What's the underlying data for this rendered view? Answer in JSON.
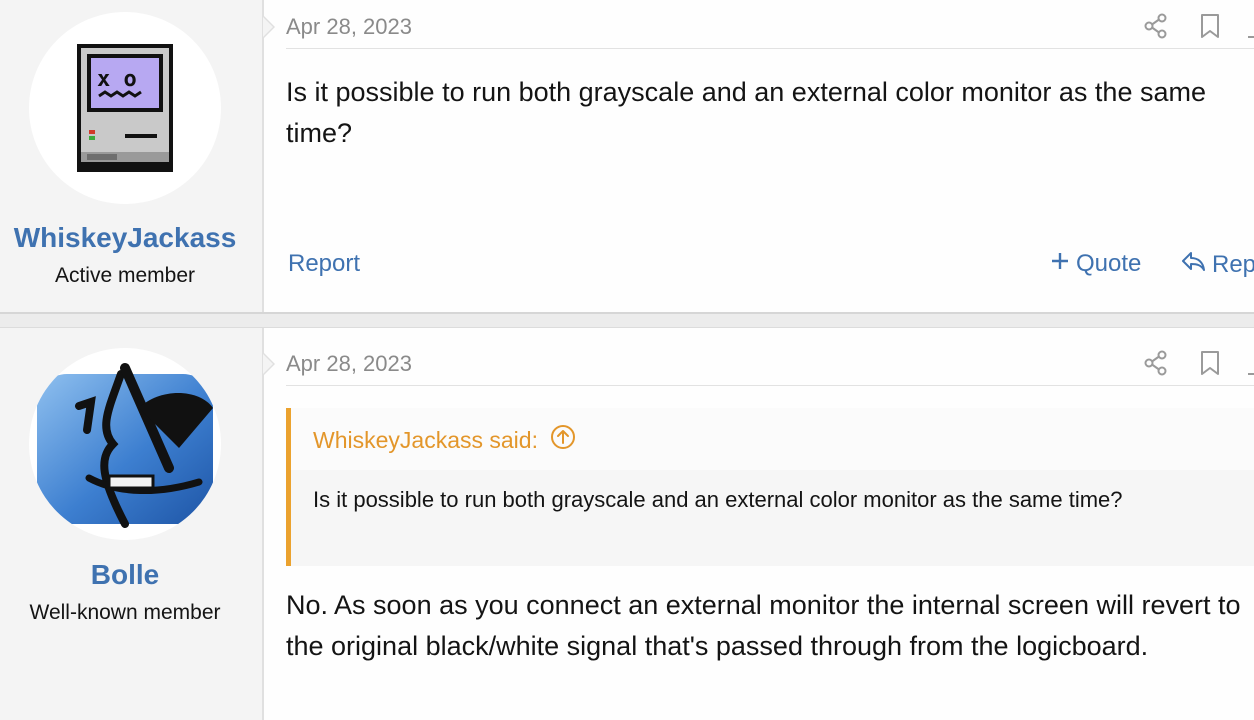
{
  "posts": [
    {
      "username": "WhiskeyJackass",
      "user_title": "Active member",
      "date": "Apr 28, 2023",
      "body": "Is it possible to run both grayscale and an external color monitor as the same time?",
      "actions": {
        "report": "Report",
        "quote": "Quote",
        "reply": "Rep"
      }
    },
    {
      "username": "Bolle",
      "user_title": "Well-known member",
      "date": "Apr 28, 2023",
      "quote": {
        "author": "WhiskeyJackass said:",
        "text": "Is it possible to run both grayscale and an external color monitor as the same time?"
      },
      "body": "No. As soon as you connect an external monitor the internal screen will revert to the original black/white signal that's passed through from the logicboard."
    }
  ],
  "icons": {
    "share": "share-icon",
    "bookmark": "bookmark-icon",
    "plus": "plus-icon",
    "reply": "reply-arrow-icon",
    "goto": "arrow-up-circle-icon"
  },
  "colors": {
    "link": "#3f72b0",
    "quote_accent": "#eba22e",
    "quote_author": "#e3962a",
    "date": "#8a8a8a",
    "user_bg": "#f4f4f4"
  }
}
